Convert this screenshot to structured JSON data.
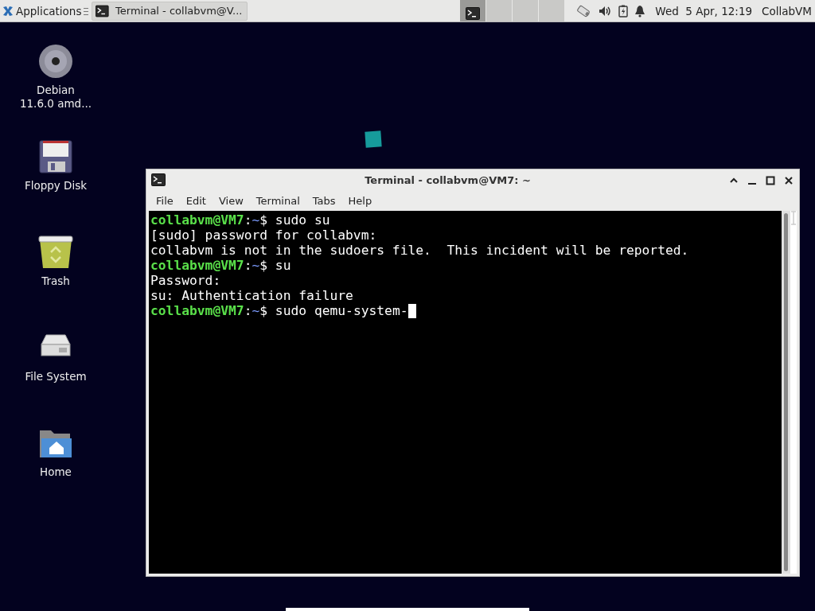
{
  "taskbar": {
    "applications_menu": "Applications",
    "window_buttons": [
      {
        "label": "Terminal - collabvm@V...",
        "selected": false
      }
    ],
    "workspaces": [
      {
        "selected": true
      },
      {
        "selected": false
      },
      {
        "selected": false
      },
      {
        "selected": false
      }
    ],
    "clock": "Wed  5 Apr, 12:19",
    "user": "CollabVM"
  },
  "desktop_icons": [
    {
      "kind": "disc",
      "label": "Debian\n11.6.0 amd..."
    },
    {
      "kind": "floppy",
      "label": "Floppy Disk"
    },
    {
      "kind": "trash",
      "label": "Trash"
    },
    {
      "kind": "drive",
      "label": "File System"
    },
    {
      "kind": "home",
      "label": "Home"
    }
  ],
  "window": {
    "title": "Terminal - collabvm@VM7: ~",
    "menu": [
      "File",
      "Edit",
      "View",
      "Terminal",
      "Tabs",
      "Help"
    ],
    "lines": [
      {
        "kind": "prompt",
        "user": "collabvm@VM7",
        "sep": ":",
        "path": "~",
        "symbol": "$",
        "command": " sudo su",
        "cursor": false
      },
      {
        "kind": "output",
        "text": "[sudo] password for collabvm:"
      },
      {
        "kind": "output",
        "text": "collabvm is not in the sudoers file.  This incident will be reported."
      },
      {
        "kind": "prompt",
        "user": "collabvm@VM7",
        "sep": ":",
        "path": "~",
        "symbol": "$",
        "command": " su",
        "cursor": false
      },
      {
        "kind": "output",
        "text": "Password:"
      },
      {
        "kind": "output",
        "text": "su: Authentication failure"
      },
      {
        "kind": "prompt",
        "user": "collabvm@VM7",
        "sep": ":",
        "path": "~",
        "symbol": "$",
        "command": " sudo qemu-system-",
        "cursor": true
      }
    ]
  }
}
